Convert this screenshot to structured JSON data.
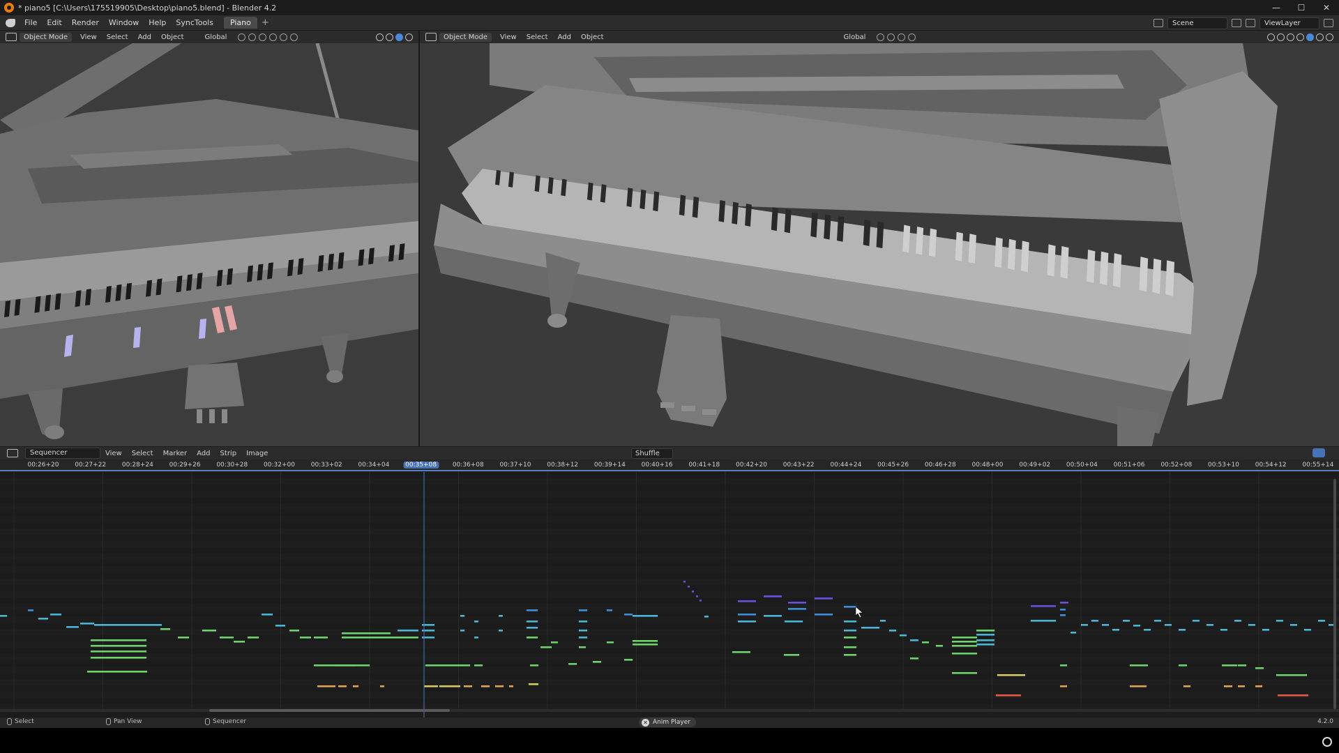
{
  "titlebar": {
    "title": "* piano5 [C:\\Users\\175519905\\Desktop\\piano5.blend] - Blender 4.2",
    "minimize": "—",
    "maximize": "☐",
    "close": "✕"
  },
  "menubar": {
    "items": [
      "File",
      "Edit",
      "Render",
      "Window",
      "Help",
      "SyncTools"
    ],
    "workspace_tab": "Piano",
    "add_workspace": "+",
    "scene": "Scene",
    "view_layer": "ViewLayer"
  },
  "viewport_left": {
    "mode": "Object Mode",
    "menus": [
      "View",
      "Select",
      "Add",
      "Object"
    ],
    "transform_orientation": "Global"
  },
  "viewport_right": {
    "mode": "Object Mode",
    "menus": [
      "View",
      "Select",
      "Add",
      "Object"
    ],
    "transform_orientation": "Global"
  },
  "sequencer": {
    "view_type": "Sequencer",
    "menus": [
      "View",
      "Select",
      "Marker",
      "Add",
      "Strip",
      "Image"
    ],
    "shuffle": "Shuffle",
    "current_time": "00:35+08",
    "ruler_ticks": [
      "00:26+20",
      "00:27+22",
      "00:28+24",
      "00:29+26",
      "00:30+28",
      "00:32+00",
      "00:33+02",
      "00:34+04",
      "00:35+08",
      "00:36+08",
      "00:37+10",
      "00:38+12",
      "00:39+14",
      "00:40+16",
      "00:41+18",
      "00:42+20",
      "00:43+22",
      "00:44+24",
      "00:45+26",
      "00:46+28",
      "00:48+00",
      "00:49+02",
      "00:50+04",
      "00:51+06",
      "00:52+08",
      "00:53+10",
      "00:54+12",
      "00:55+14"
    ]
  },
  "statusbar": {
    "select": "Select",
    "pan_view": "Pan View",
    "sequencer": "Sequencer",
    "anim_player": "Anim Player",
    "version": "4.2.0"
  },
  "colors": {
    "accent": "#4772b3",
    "strip_blue": "#3f8fd8",
    "strip_cyan": "#49b6d6",
    "strip_green": "#6fd36b",
    "strip_yellow": "#d6c85a",
    "strip_orange": "#e0a44a",
    "strip_purple": "#6a4fe0",
    "strip_red": "#e05a4a"
  }
}
